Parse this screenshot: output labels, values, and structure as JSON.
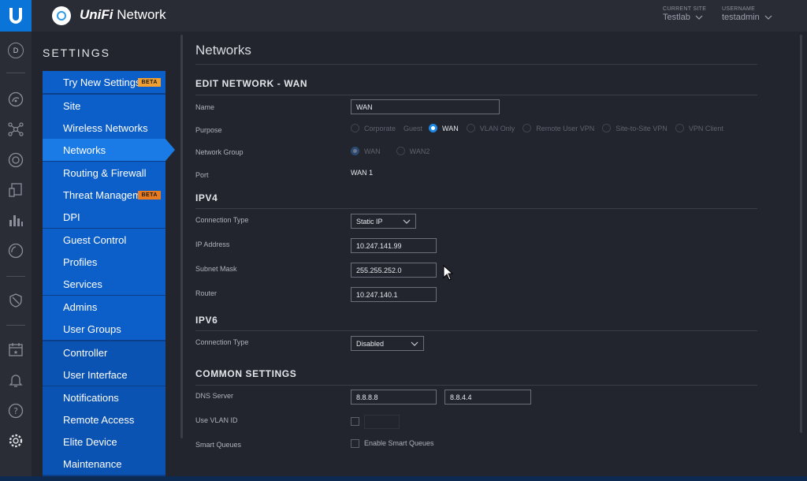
{
  "app": {
    "brand_prefix": "UniFi",
    "brand_suffix": " Network"
  },
  "header": {
    "current_site_label": "CURRENT SITE",
    "current_site": "Testlab",
    "username_label": "USERNAME",
    "username": "testadmin"
  },
  "rail": {
    "avatar_letter": "D"
  },
  "settings": {
    "title": "SETTINGS",
    "items": [
      {
        "label": "Try New Settings",
        "badge": "BETA"
      },
      {
        "label": "Site"
      },
      {
        "label": "Wireless Networks"
      },
      {
        "label": "Networks"
      },
      {
        "label": "Routing & Firewall"
      },
      {
        "label": "Threat Management",
        "badge": "BETA"
      },
      {
        "label": "DPI"
      },
      {
        "label": "Guest Control"
      },
      {
        "label": "Profiles"
      },
      {
        "label": "Services"
      },
      {
        "label": "Admins"
      },
      {
        "label": "User Groups"
      },
      {
        "label": "Controller"
      },
      {
        "label": "User Interface"
      },
      {
        "label": "Notifications"
      },
      {
        "label": "Remote Access"
      },
      {
        "label": "Elite Device"
      },
      {
        "label": "Maintenance"
      }
    ],
    "active": "Networks"
  },
  "main": {
    "page_title": "Networks",
    "edit_section": "EDIT NETWORK - WAN",
    "name_label": "Name",
    "name_value": "WAN",
    "purpose_label": "Purpose",
    "purpose_options": [
      "Corporate",
      "Guest",
      "WAN",
      "VLAN Only",
      "Remote User VPN",
      "Site-to-Site VPN",
      "VPN Client"
    ],
    "purpose_selected": "WAN",
    "network_group_label": "Network Group",
    "network_group_options": [
      "WAN",
      "WAN2"
    ],
    "port_label": "Port",
    "port_value": "WAN 1",
    "ipv4_section": "IPV4",
    "connection_type_label": "Connection Type",
    "connection_type_value": "Static IP",
    "ip_address_label": "IP Address",
    "ip_address_value": "10.247.141.99",
    "subnet_mask_label": "Subnet Mask",
    "subnet_mask_value": "255.255.252.0",
    "router_label": "Router",
    "router_value": "10.247.140.1",
    "ipv6_section": "IPV6",
    "ipv6_connection_type_label": "Connection Type",
    "ipv6_connection_type_value": "Disabled",
    "common_section": "COMMON SETTINGS",
    "dns_label": "DNS Server",
    "dns1": "8.8.8.8",
    "dns2": "8.8.4.4",
    "vlan_label": "Use VLAN ID",
    "smart_queues_label": "Smart Queues",
    "smart_queues_checkbox_label": "Enable Smart Queues"
  },
  "colors": {
    "accent": "#1e88e5",
    "menu": "#0c5fc9",
    "menu_active": "#1a7be6",
    "beta": "#e87a1f"
  }
}
